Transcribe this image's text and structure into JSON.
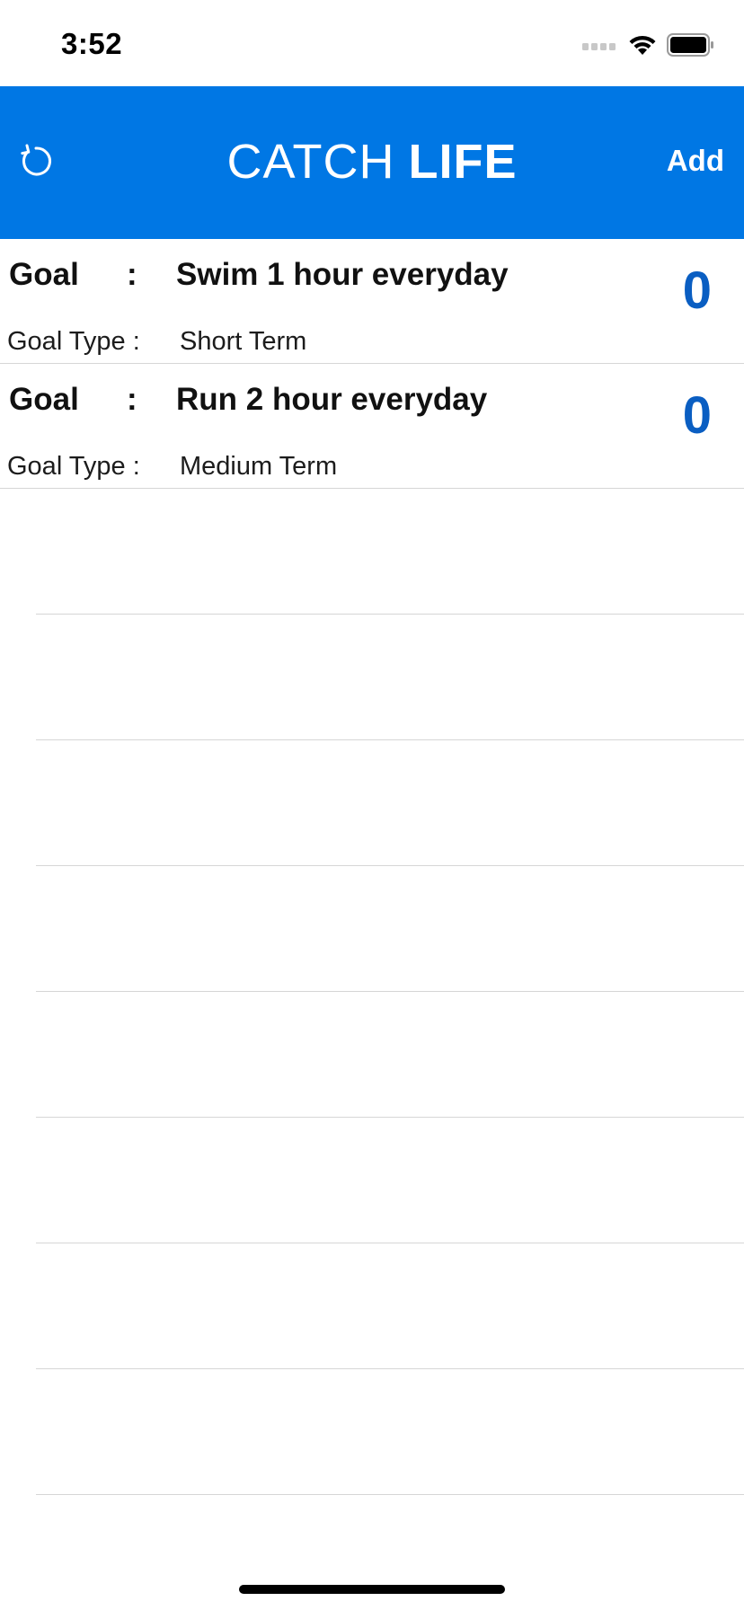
{
  "status_bar": {
    "time": "3:52"
  },
  "nav": {
    "title_thin": "CATCH",
    "title_bold": "LIFE",
    "add_label": "Add",
    "background_color": "#0077e4",
    "refresh_icon": "refresh-icon"
  },
  "goals": [
    {
      "label": "Goal",
      "colon": ":",
      "title": "Swim 1 hour everyday",
      "count": "0",
      "type_label": "Goal Type :",
      "type_value": "Short Term"
    },
    {
      "label": "Goal",
      "colon": ":",
      "title": "Run 2 hour everyday",
      "count": "0",
      "type_label": "Goal Type :",
      "type_value": "Medium Term"
    }
  ],
  "colors": {
    "count": "#0a5ec2",
    "separator": "#d6d6d6"
  }
}
